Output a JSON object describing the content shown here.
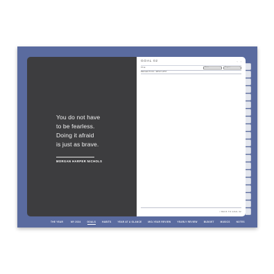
{
  "quote": {
    "lines": [
      "You do not have",
      "to be fearless.",
      "Doing it afraid",
      "is just as brave."
    ],
    "author": "MORGAN HARPER NICHOLS"
  },
  "goal_page": {
    "title": "GOAL 02",
    "prev_arrow": "‹",
    "next_arrow": "›",
    "field_label": "TITLE",
    "status_1": "Status",
    "status_2": "Progress",
    "section_label": "REFLECTION / WHAT WHY",
    "footer_link": "< BACK TO GOAL 02"
  },
  "side_tabs_count": 20,
  "nav": {
    "items": [
      {
        "label": "THE YEAR",
        "active": false
      },
      {
        "label": "MY 2024",
        "active": false
      },
      {
        "label": "GOALS",
        "active": true
      },
      {
        "label": "HABITS",
        "active": false
      },
      {
        "label": "YEAR AT A GLANCE",
        "active": false
      },
      {
        "label": "MID-YEAR REVIEW",
        "active": false
      },
      {
        "label": "YEARLY REVIEW",
        "active": false
      },
      {
        "label": "BUDGET",
        "active": false
      },
      {
        "label": "MUSICS",
        "active": false
      },
      {
        "label": "NOTES",
        "active": false
      }
    ]
  },
  "colors": {
    "frame": "#5a6b9f",
    "quote_panel": "#3d3d3f",
    "page": "#ffffff",
    "tab": "#e3e6ee"
  }
}
